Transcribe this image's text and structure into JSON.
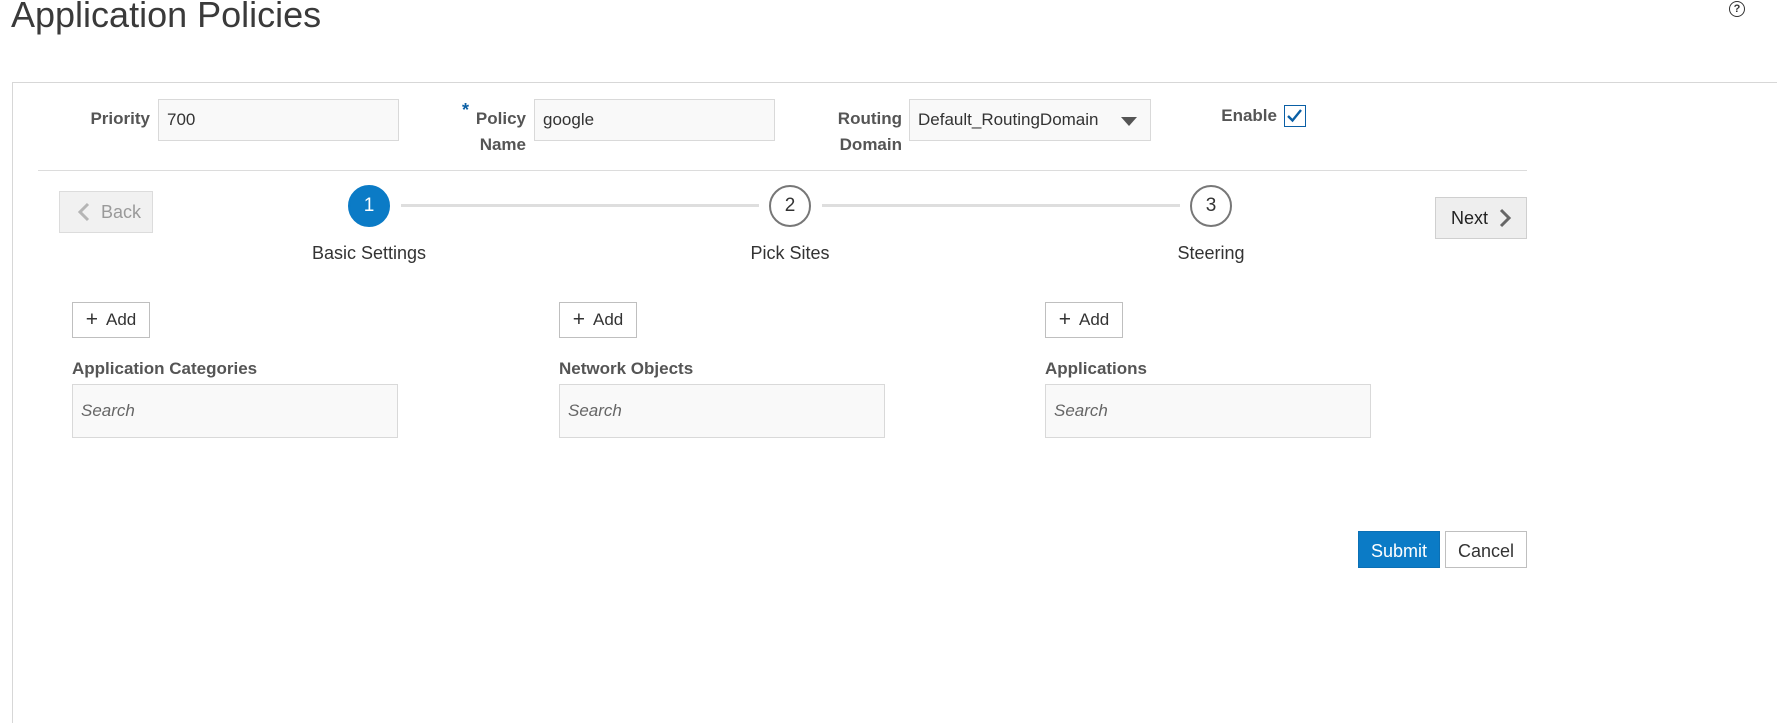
{
  "page": {
    "title": "Application Policies"
  },
  "help": {
    "glyph": "?"
  },
  "form": {
    "priority": {
      "label": "Priority",
      "value": "700"
    },
    "policy_name": {
      "required_marker": "*",
      "label_line1": "Policy",
      "label_line2": "Name",
      "value": "google"
    },
    "routing_domain": {
      "label_line1": "Routing",
      "label_line2": "Domain",
      "selected": "Default_RoutingDomain"
    },
    "enable": {
      "label": "Enable",
      "checked": true
    }
  },
  "wizard": {
    "back_label": "Back",
    "next_label": "Next",
    "steps": [
      {
        "number": "1",
        "label": "Basic Settings"
      },
      {
        "number": "2",
        "label": "Pick Sites"
      },
      {
        "number": "3",
        "label": "Steering"
      }
    ]
  },
  "columns": [
    {
      "add_label": "Add",
      "label": "Application Categories",
      "search_placeholder": "Search"
    },
    {
      "add_label": "Add",
      "label": "Network Objects",
      "search_placeholder": "Search"
    },
    {
      "add_label": "Add",
      "label": "Applications",
      "search_placeholder": "Search"
    }
  ],
  "actions": {
    "submit_label": "Submit",
    "cancel_label": "Cancel"
  },
  "colors": {
    "accent": "#0b7bc6",
    "required": "#0a5fa5"
  }
}
